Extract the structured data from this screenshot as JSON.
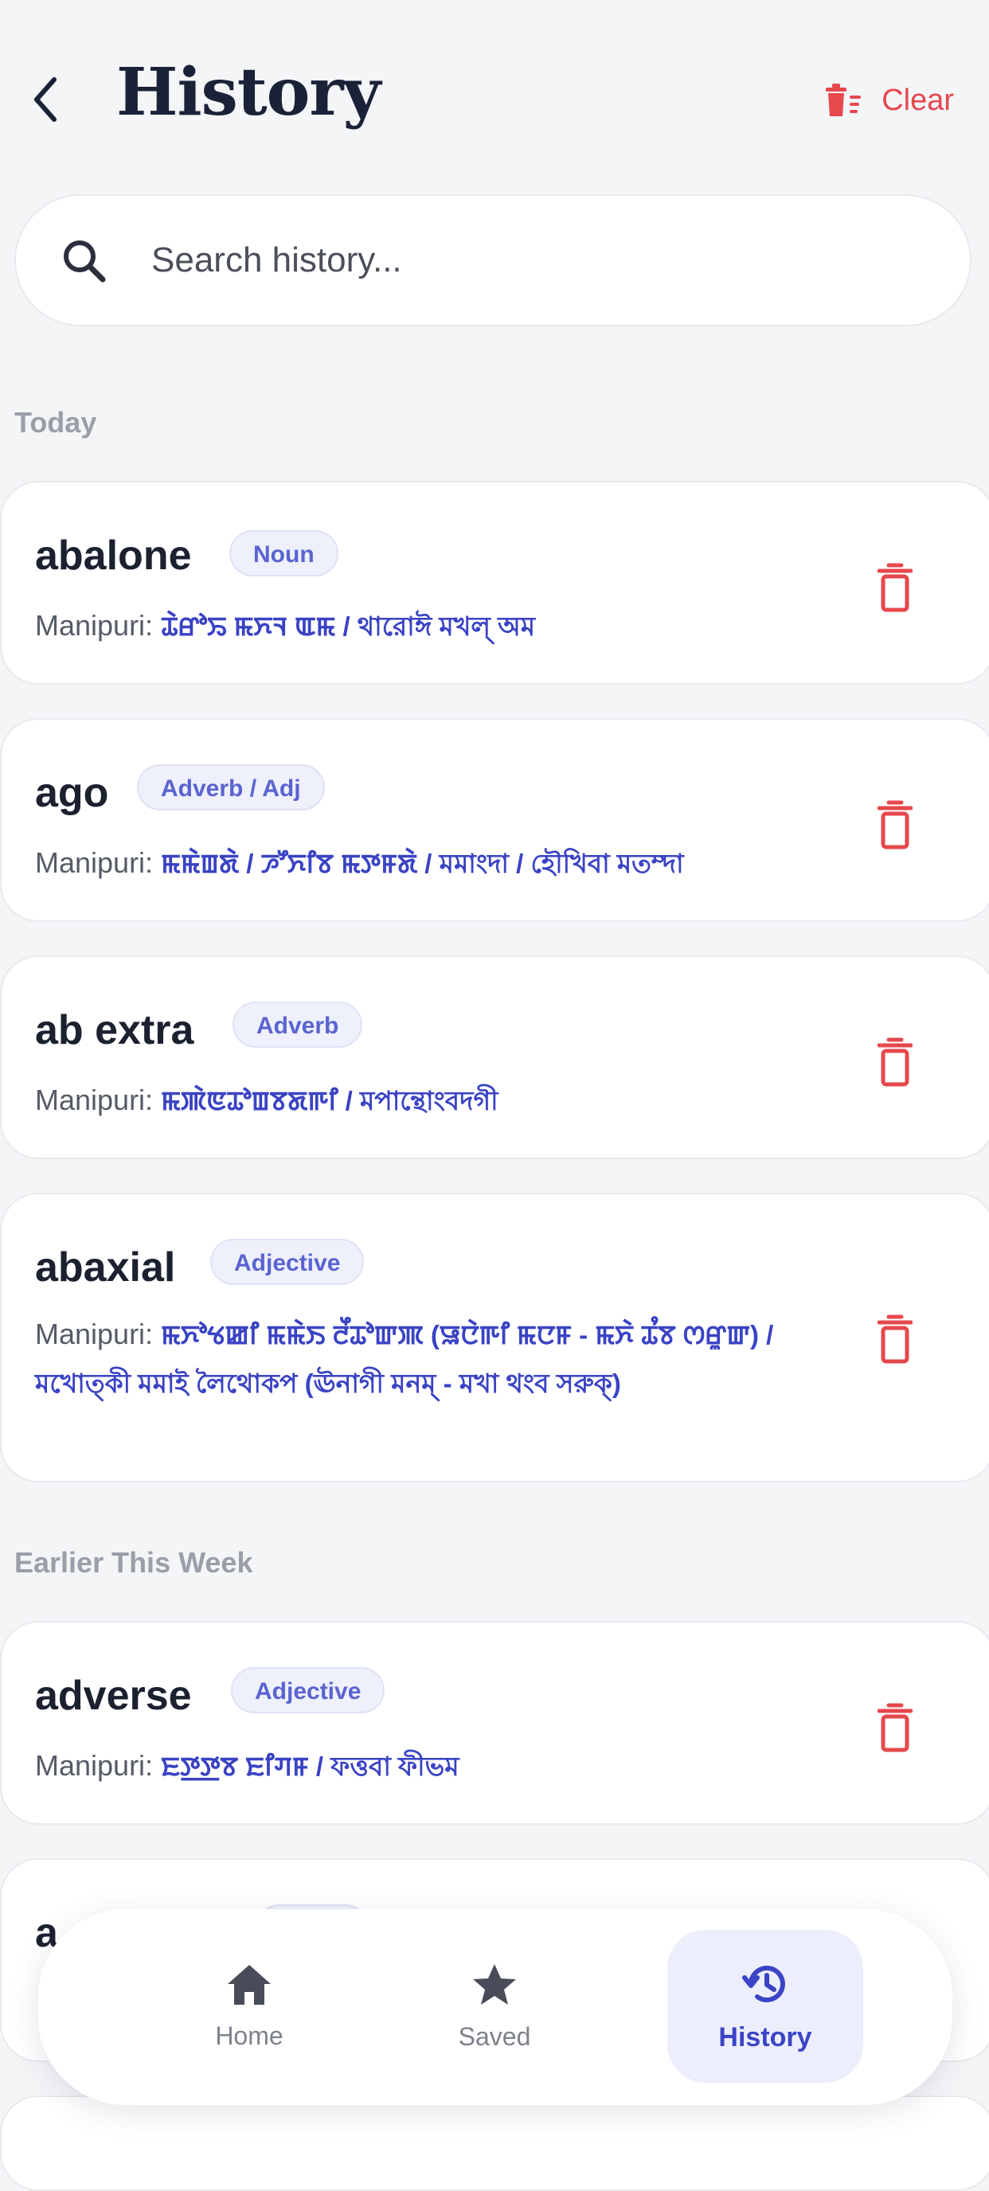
{
  "header": {
    "title": "History",
    "clear_label": "Clear"
  },
  "search": {
    "placeholder": "Search history..."
  },
  "sections": {
    "today": "Today",
    "earlier": "Earlier This Week"
  },
  "entries": [
    {
      "word": "abalone",
      "pos": "Noun",
      "label": "Manipuri:",
      "meaning": "ꯊꯥꯔꯣꯢ ꯃꯈꯜ ꯑꯃ / থারোঈ মখল্ অম"
    },
    {
      "word": "ago",
      "pos": "Adverb / Adj",
      "label": "Manipuri:",
      "meaning": "ꯃꯃꯥꯡꯗꯥ / ꯍꯧꯈꯤꯕ ꯃꯇꯝꯗꯥ / মমাংদা / হৌখিবা মতম্দা"
    },
    {
      "word": "ab extra",
      "pos": "Adverb",
      "label": "Manipuri:",
      "meaning": "ꯃꯄꯥꯟꯊꯣꯡꯕꯗꯒꯤ / মপান্থোংবদগী"
    },
    {
      "word": "abaxial",
      "pos": "Adjective",
      "label": "Manipuri:",
      "meaning": "ꯃꯈꯣꯠꯀꯤ ꯃꯃꯥꯏ ꯂꯩꯊꯣꯛꯄ (ꯎꯅꯥꯒꯤ ꯃꯅꯝ - ꯃꯈꯥ ꯊꯪꯕ ꯁꯔꯨꯛ) / মখোত্কী মমাই লৈথোকপ (ঊনাগী মনম্ - মখা থংব সরুক্)"
    },
    {
      "word": "adverse",
      "pos": "Adjective",
      "label": "Manipuri:",
      "meaning": "ꯐꯇ꯭ꯇꯕ ꯐꯤꯚꯝ / ফত্তবা ফীভম"
    },
    {
      "word": "a",
      "pos": "",
      "label": "",
      "meaning": ""
    }
  ],
  "nav": {
    "home_label": "Home",
    "saved_label": "Saved",
    "history_label": "History"
  },
  "colors": {
    "accent": "#3b44c6",
    "danger": "#e5484d",
    "badge_bg": "#eef0fb"
  },
  "icons": {
    "back": "chevron-left-icon",
    "clear": "clear-list-icon",
    "search": "search-icon",
    "delete": "trash-icon",
    "home": "home-icon",
    "saved": "star-icon",
    "history": "history-icon"
  }
}
